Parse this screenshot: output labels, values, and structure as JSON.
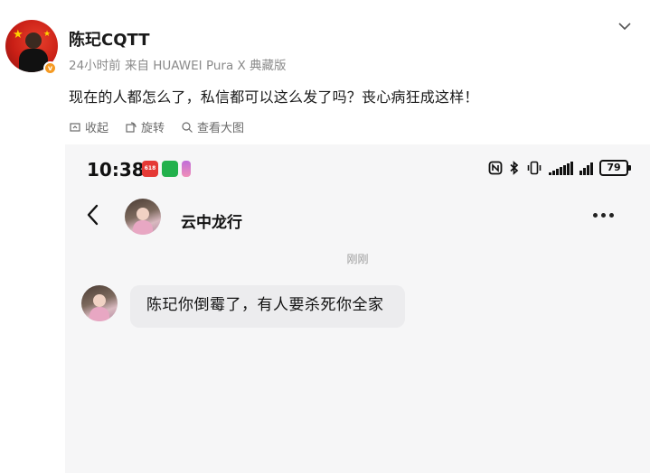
{
  "post": {
    "username": "陈玘CQTT",
    "meta": "24小时前 来自 HUAWEI Pura X 典藏版",
    "text": "现在的人都怎么了，私信都可以这么发了吗？丧心病狂成这样！",
    "actions": {
      "collapse": "收起",
      "rotate": "旋转",
      "view_large": "查看大图"
    }
  },
  "screenshot": {
    "status_bar": {
      "time": "10:38",
      "battery": "79",
      "app_badge": "618"
    },
    "chat": {
      "contact_name": "云中龙行",
      "timestamp": "刚刚",
      "message": "陈玘你倒霉了，有人要杀死你全家"
    }
  },
  "colors": {
    "badge_orange": "#f59a23",
    "bubble_gray": "#ececee",
    "avatar_red": "#c91f16"
  },
  "icons": [
    "verified-badge-icon",
    "chevron-down-icon",
    "collapse-icon",
    "rotate-icon",
    "zoom-icon",
    "back-arrow-icon",
    "more-icon",
    "nfc-icon",
    "bluetooth-icon",
    "vibrate-icon",
    "signal-icon",
    "battery-icon"
  ]
}
